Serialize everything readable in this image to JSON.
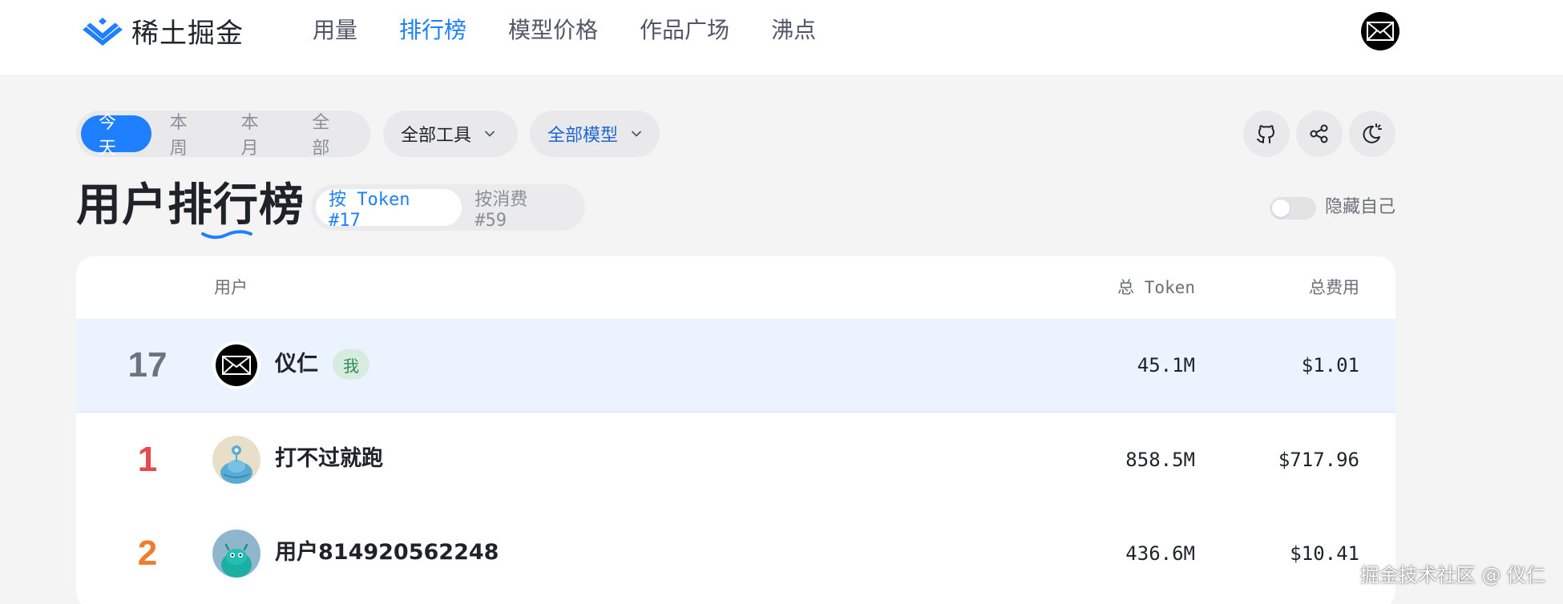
{
  "brand": {
    "name": "稀土掘金",
    "color": "#1e80ff"
  },
  "nav": [
    {
      "label": "用量",
      "active": false
    },
    {
      "label": "排行榜",
      "active": true
    },
    {
      "label": "模型价格",
      "active": false
    },
    {
      "label": "作品广场",
      "active": false
    },
    {
      "label": "沸点",
      "active": false
    }
  ],
  "filters": {
    "periods": [
      "今天",
      "本周",
      "本月",
      "全部"
    ],
    "active_period": "今天",
    "tools_dropdown": "全部工具",
    "models_dropdown": "全部模型"
  },
  "actions": {
    "icons": [
      "github-icon",
      "share-icon",
      "theme-icon"
    ]
  },
  "page": {
    "title": "用户排行榜",
    "sort_options": [
      "按 Token #17",
      "按消费 #59"
    ],
    "active_sort": "按 Token #17",
    "hide_self_label": "隐藏自己",
    "hide_self_on": false
  },
  "table": {
    "columns": {
      "user": "用户",
      "tokens": "总 Token",
      "cost": "总费用"
    },
    "rows": [
      {
        "rank": "17",
        "name": "仪仁",
        "badge": "我",
        "tokens": "45.1M",
        "cost": "$1.01",
        "rank_color": "#6b7280",
        "highlight": true
      },
      {
        "rank": "1",
        "name": "打不过就跑",
        "badge": "",
        "tokens": "858.5M",
        "cost": "$717.96",
        "rank_color": "#e5484d",
        "highlight": false
      },
      {
        "rank": "2",
        "name": "用户814920562248",
        "badge": "",
        "tokens": "436.6M",
        "cost": "$10.41",
        "rank_color": "#f07c2e",
        "highlight": false
      }
    ]
  },
  "watermark": "掘金技术社区 @ 仪仁"
}
